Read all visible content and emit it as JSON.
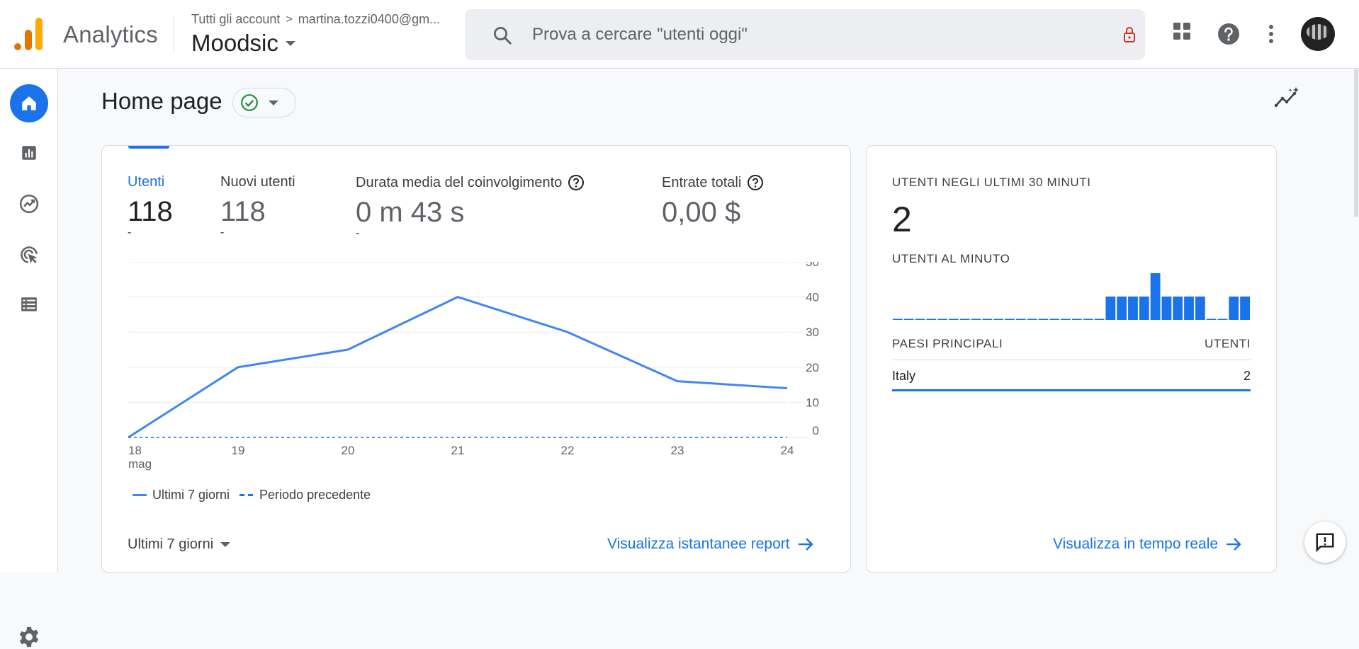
{
  "header": {
    "app_name": "Analytics",
    "account_crumb_root": "Tutti gli account",
    "account_crumb_sep": ">",
    "account_email": "martina.tozzi0400@gm...",
    "property_name": "Moodsic",
    "search_placeholder": "Prova a cercare \"utenti oggi\"",
    "icons": [
      "search-icon",
      "lock-icon",
      "apps-grid-icon",
      "help-icon",
      "more-vert-icon",
      "avatar"
    ]
  },
  "rail": {
    "items": [
      "home-icon",
      "reports-icon",
      "explore-icon",
      "advertising-icon",
      "configure-icon"
    ],
    "settings": "settings-icon"
  },
  "page": {
    "title": "Home page"
  },
  "metrics": [
    {
      "label": "Utenti",
      "value": "118",
      "delta": "-"
    },
    {
      "label": "Nuovi utenti",
      "value": "118",
      "delta": "-"
    },
    {
      "label": "Durata media del coinvolgimento",
      "value": "0 m 43 s",
      "delta": "-"
    },
    {
      "label": "Entrate totali",
      "value": "0,00 $",
      "delta": ""
    }
  ],
  "chart_data": {
    "type": "line",
    "x": [
      "18",
      "19",
      "20",
      "21",
      "22",
      "23",
      "24"
    ],
    "x_sublabel": {
      "18": "mag"
    },
    "yticks": [
      "50",
      "40",
      "30",
      "20",
      "10",
      "0"
    ],
    "ylim": [
      0,
      50
    ],
    "series": [
      {
        "name": "Ultimi 7 giorni",
        "values": [
          0,
          20,
          25,
          40,
          30,
          16,
          14
        ],
        "style": "solid",
        "color": "#4285f4"
      },
      {
        "name": "Periodo precedente",
        "values": [
          0,
          0,
          0,
          0,
          0,
          0,
          0
        ],
        "style": "dashed",
        "color": "#1a73e8"
      }
    ],
    "grid": true,
    "legend": "bottom-left"
  },
  "main_card": {
    "range_label": "Ultimi 7 giorni",
    "report_link": "Visualizza istantanee report"
  },
  "realtime": {
    "title": "UTENTI NEGLI ULTIMI 30 MINUTI",
    "value": "2",
    "per_minute_label": "UTENTI AL MINUTO",
    "per_minute_values": [
      0,
      0,
      0,
      0,
      0,
      0,
      0,
      0,
      0,
      0,
      0,
      0,
      0,
      0,
      0,
      0,
      0,
      0,
      0,
      1,
      1,
      1,
      1,
      2,
      1,
      1,
      1,
      1,
      0,
      0,
      1,
      1
    ],
    "table_headers": [
      "PAESI PRINCIPALI",
      "UTENTI"
    ],
    "rows": [
      {
        "country": "Italy",
        "users": "2"
      }
    ],
    "link": "Visualizza in tempo reale"
  },
  "colors": {
    "accent": "#1a73e8",
    "line": "#4285f4",
    "status_ok": "#1e8e3e",
    "logo_orange": "#f9ab00",
    "logo_dark_orange": "#e37400"
  }
}
